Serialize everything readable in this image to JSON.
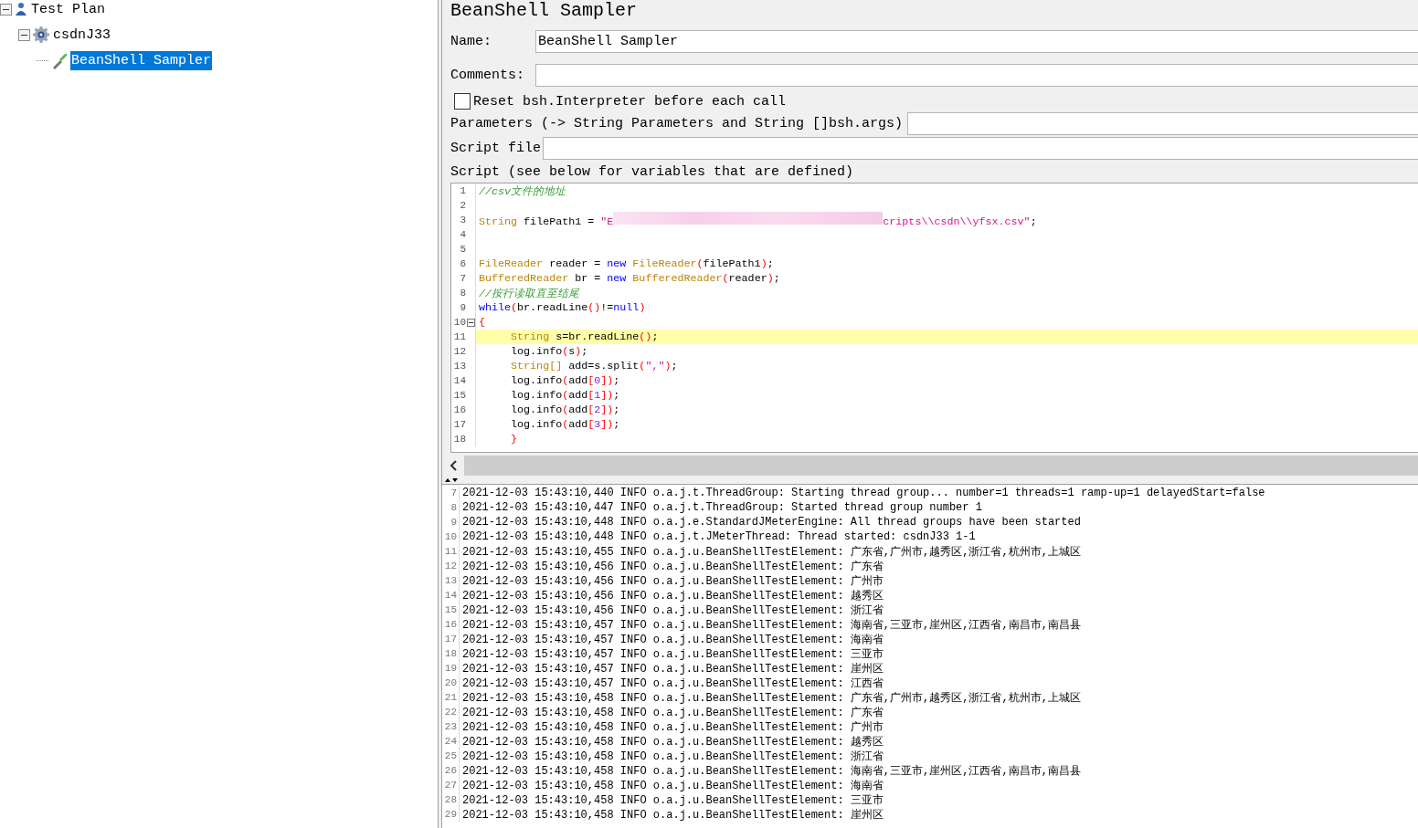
{
  "tree": [
    {
      "label": "Test Plan",
      "kind": "plan",
      "selected": false,
      "expanded": true,
      "children": [
        {
          "label": "csdnJ33",
          "kind": "gear",
          "selected": false,
          "expanded": true,
          "children": [
            {
              "label": "BeanShell Sampler",
              "kind": "dropper",
              "selected": true
            }
          ]
        }
      ]
    }
  ],
  "panel": {
    "title": "BeanShell Sampler",
    "name": {
      "label": "Name:",
      "value": "BeanShell Sampler"
    },
    "comments": {
      "label": "Comments:"
    },
    "reset": {
      "label": "Reset bsh.Interpreter before each call",
      "checked": false
    },
    "parameters": {
      "label": "Parameters (-> String Parameters and String []bsh.args)"
    },
    "script_file": {
      "label": "Script file"
    },
    "script_label": "Script (see below for variables that are defined)"
  },
  "code": [
    {
      "n": "1",
      "tokens": [
        {
          "kind": "comment",
          "text": "//csv文件的地址"
        }
      ]
    },
    {
      "n": "2"
    },
    {
      "n": "3",
      "tokens": [
        {
          "kind": "type",
          "text": "String"
        },
        {
          "kind": "plain",
          "text": " filePath1 = "
        },
        {
          "kind": "str",
          "text": "\"E"
        },
        {
          "kind": "redacted"
        },
        {
          "kind": "str",
          "text": "cripts\\\\csdn\\\\yfsx.csv\""
        },
        {
          "kind": "plain",
          "text": ";"
        }
      ]
    },
    {
      "n": "4"
    },
    {
      "n": "5"
    },
    {
      "n": "6",
      "tokens": [
        {
          "kind": "type",
          "text": "FileReader"
        },
        {
          "kind": "plain",
          "text": " reader = "
        },
        {
          "kind": "kw",
          "text": "new"
        },
        {
          "kind": "type",
          "text": " FileReader"
        },
        {
          "kind": "paren",
          "text": "("
        },
        {
          "kind": "plain",
          "text": "filePath1"
        },
        {
          "kind": "paren",
          "text": ")"
        },
        {
          "kind": "plain",
          "text": ";"
        }
      ]
    },
    {
      "n": "7",
      "tokens": [
        {
          "kind": "type",
          "text": "BufferedReader"
        },
        {
          "kind": "plain",
          "text": " br = "
        },
        {
          "kind": "kw",
          "text": "new"
        },
        {
          "kind": "type",
          "text": " BufferedReader"
        },
        {
          "kind": "paren",
          "text": "("
        },
        {
          "kind": "plain",
          "text": "reader"
        },
        {
          "kind": "paren",
          "text": ")"
        },
        {
          "kind": "plain",
          "text": ";"
        }
      ]
    },
    {
      "n": "8",
      "tokens": [
        {
          "kind": "comment",
          "text": "//按行读取直至结尾"
        }
      ]
    },
    {
      "n": "9",
      "tokens": [
        {
          "kind": "kw",
          "text": "while"
        },
        {
          "kind": "paren",
          "text": "("
        },
        {
          "kind": "plain",
          "text": "br.readLine"
        },
        {
          "kind": "paren",
          "text": "()"
        },
        {
          "kind": "plain",
          "text": "!="
        },
        {
          "kind": "kw",
          "text": "null"
        },
        {
          "kind": "paren",
          "text": ")"
        }
      ]
    },
    {
      "n": "10",
      "fold": true,
      "tokens": [
        {
          "kind": "paren",
          "text": "{"
        }
      ]
    },
    {
      "n": "11",
      "highlighted": true,
      "tokens": [
        {
          "kind": "type",
          "text": "     String"
        },
        {
          "kind": "plain",
          "text": " s=br.readLine"
        },
        {
          "kind": "paren",
          "text": "()"
        },
        {
          "kind": "plain",
          "text": ";"
        }
      ]
    },
    {
      "n": "12",
      "tokens": [
        {
          "kind": "plain",
          "text": "     log.info"
        },
        {
          "kind": "paren",
          "text": "("
        },
        {
          "kind": "plain",
          "text": "s"
        },
        {
          "kind": "paren",
          "text": ")"
        },
        {
          "kind": "plain",
          "text": ";"
        }
      ]
    },
    {
      "n": "13",
      "tokens": [
        {
          "kind": "type",
          "text": "     String[]"
        },
        {
          "kind": "plain",
          "text": " add=s.split"
        },
        {
          "kind": "paren",
          "text": "("
        },
        {
          "kind": "str",
          "text": "\",\""
        },
        {
          "kind": "paren",
          "text": ")"
        },
        {
          "kind": "plain",
          "text": ";"
        }
      ]
    },
    {
      "n": "14",
      "tokens": [
        {
          "kind": "plain",
          "text": "     log.info"
        },
        {
          "kind": "paren",
          "text": "("
        },
        {
          "kind": "plain",
          "text": "add"
        },
        {
          "kind": "paren",
          "text": "["
        },
        {
          "kind": "num",
          "text": "0"
        },
        {
          "kind": "paren",
          "text": "])"
        },
        {
          "kind": "plain",
          "text": ";"
        }
      ]
    },
    {
      "n": "15",
      "tokens": [
        {
          "kind": "plain",
          "text": "     log.info"
        },
        {
          "kind": "paren",
          "text": "("
        },
        {
          "kind": "plain",
          "text": "add"
        },
        {
          "kind": "paren",
          "text": "["
        },
        {
          "kind": "num",
          "text": "1"
        },
        {
          "kind": "paren",
          "text": "])"
        },
        {
          "kind": "plain",
          "text": ";"
        }
      ]
    },
    {
      "n": "16",
      "tokens": [
        {
          "kind": "plain",
          "text": "     log.info"
        },
        {
          "kind": "paren",
          "text": "("
        },
        {
          "kind": "plain",
          "text": "add"
        },
        {
          "kind": "paren",
          "text": "["
        },
        {
          "kind": "num",
          "text": "2"
        },
        {
          "kind": "paren",
          "text": "])"
        },
        {
          "kind": "plain",
          "text": ";"
        }
      ]
    },
    {
      "n": "17",
      "tokens": [
        {
          "kind": "plain",
          "text": "     log.info"
        },
        {
          "kind": "paren",
          "text": "("
        },
        {
          "kind": "plain",
          "text": "add"
        },
        {
          "kind": "paren",
          "text": "["
        },
        {
          "kind": "num",
          "text": "3"
        },
        {
          "kind": "paren",
          "text": "])"
        },
        {
          "kind": "plain",
          "text": ";"
        }
      ]
    },
    {
      "n": "18",
      "tokens": [
        {
          "kind": "paren",
          "text": "     }"
        }
      ]
    }
  ],
  "log": [
    {
      "n": "7",
      "text": "2021-12-03 15:43:10,440 INFO o.a.j.t.ThreadGroup: Starting thread group... number=1 threads=1 ramp-up=1 delayedStart=false"
    },
    {
      "n": "8",
      "text": "2021-12-03 15:43:10,447 INFO o.a.j.t.ThreadGroup: Started thread group number 1"
    },
    {
      "n": "9",
      "text": "2021-12-03 15:43:10,448 INFO o.a.j.e.StandardJMeterEngine: All thread groups have been started"
    },
    {
      "n": "10",
      "text": "2021-12-03 15:43:10,448 INFO o.a.j.t.JMeterThread: Thread started: csdnJ33 1-1"
    },
    {
      "n": "11",
      "text": "2021-12-03 15:43:10,455 INFO o.a.j.u.BeanShellTestElement: 广东省,广州市,越秀区,浙江省,杭州市,上城区"
    },
    {
      "n": "12",
      "text": "2021-12-03 15:43:10,456 INFO o.a.j.u.BeanShellTestElement: 广东省"
    },
    {
      "n": "13",
      "text": "2021-12-03 15:43:10,456 INFO o.a.j.u.BeanShellTestElement: 广州市"
    },
    {
      "n": "14",
      "text": "2021-12-03 15:43:10,456 INFO o.a.j.u.BeanShellTestElement: 越秀区"
    },
    {
      "n": "15",
      "text": "2021-12-03 15:43:10,456 INFO o.a.j.u.BeanShellTestElement: 浙江省"
    },
    {
      "n": "16",
      "text": "2021-12-03 15:43:10,457 INFO o.a.j.u.BeanShellTestElement: 海南省,三亚市,崖州区,江西省,南昌市,南昌县"
    },
    {
      "n": "17",
      "text": "2021-12-03 15:43:10,457 INFO o.a.j.u.BeanShellTestElement: 海南省"
    },
    {
      "n": "18",
      "text": "2021-12-03 15:43:10,457 INFO o.a.j.u.BeanShellTestElement: 三亚市"
    },
    {
      "n": "19",
      "text": "2021-12-03 15:43:10,457 INFO o.a.j.u.BeanShellTestElement: 崖州区"
    },
    {
      "n": "20",
      "text": "2021-12-03 15:43:10,457 INFO o.a.j.u.BeanShellTestElement: 江西省"
    },
    {
      "n": "21",
      "text": "2021-12-03 15:43:10,458 INFO o.a.j.u.BeanShellTestElement: 广东省,广州市,越秀区,浙江省,杭州市,上城区"
    },
    {
      "n": "22",
      "text": "2021-12-03 15:43:10,458 INFO o.a.j.u.BeanShellTestElement: 广东省"
    },
    {
      "n": "23",
      "text": "2021-12-03 15:43:10,458 INFO o.a.j.u.BeanShellTestElement: 广州市"
    },
    {
      "n": "24",
      "text": "2021-12-03 15:43:10,458 INFO o.a.j.u.BeanShellTestElement: 越秀区"
    },
    {
      "n": "25",
      "text": "2021-12-03 15:43:10,458 INFO o.a.j.u.BeanShellTestElement: 浙江省"
    },
    {
      "n": "26",
      "text": "2021-12-03 15:43:10,458 INFO o.a.j.u.BeanShellTestElement: 海南省,三亚市,崖州区,江西省,南昌市,南昌县"
    },
    {
      "n": "27",
      "text": "2021-12-03 15:43:10,458 INFO o.a.j.u.BeanShellTestElement: 海南省"
    },
    {
      "n": "28",
      "text": "2021-12-03 15:43:10,458 INFO o.a.j.u.BeanShellTestElement: 三亚市"
    },
    {
      "n": "29",
      "text": "2021-12-03 15:43:10,458 INFO o.a.j.u.BeanShellTestElement: 崖州区"
    }
  ]
}
